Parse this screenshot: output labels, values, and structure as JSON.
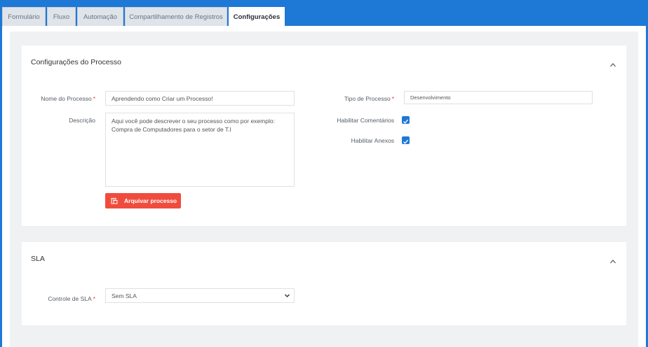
{
  "tabs": [
    {
      "label": "Formulário"
    },
    {
      "label": "Fluxo"
    },
    {
      "label": "Automação"
    },
    {
      "label": "Compartilhamento de Registros"
    },
    {
      "label": "Configurações"
    }
  ],
  "process_panel": {
    "title": "Configurações do Processo",
    "name_label": "Nome do Processo",
    "name_value": "Aprendendo como Criar um Processo!",
    "description_label": "Descrição",
    "description_value": "Aqui você pode descrever o seu processo como por exemplo: Compra de Computadores para o setor de T.I",
    "archive_button": "Arquivar processo",
    "type_label": "Tipo de Processo",
    "type_value": "Desenvolvimento",
    "comments_label": "Habilitar Comentários",
    "comments_checked": true,
    "attachments_label": "Habilitar Anexos",
    "attachments_checked": true,
    "required_mark": "*"
  },
  "sla_panel": {
    "title": "SLA",
    "control_label": "Controle de SLA",
    "control_value": "Sem SLA"
  },
  "colors": {
    "brand": "#1e78d6",
    "danger": "#f04c3e",
    "required": "#e53935"
  }
}
